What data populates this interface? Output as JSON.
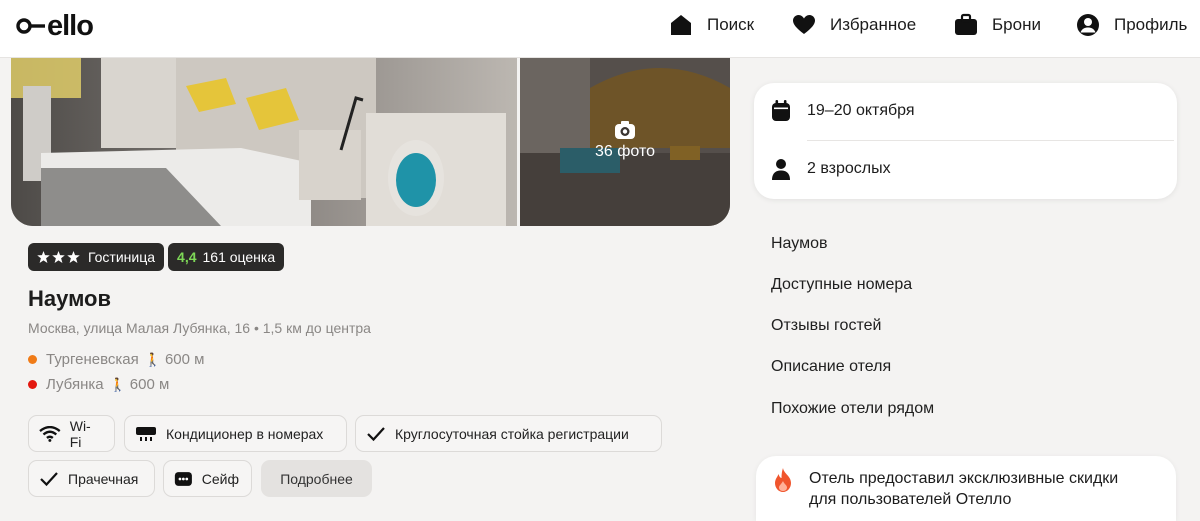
{
  "header": {
    "logo": "ello",
    "nav": [
      {
        "label": "Поиск",
        "icon": "home-icon"
      },
      {
        "label": "Избранное",
        "icon": "heart-icon"
      },
      {
        "label": "Брони",
        "icon": "suitcase-icon"
      },
      {
        "label": "Профиль",
        "icon": "user-icon"
      }
    ]
  },
  "gallery": {
    "photos_count": "36 фото"
  },
  "hotel": {
    "type_badge": "Гостиница",
    "stars": 3,
    "rating": "4,4",
    "reviews": "161 оценка",
    "name": "Наумов",
    "address": "Москва, улица Малая Лубянка, 16 • 1,5 км до центра",
    "metro": [
      {
        "station": "Тургеневская",
        "distance": "600 м",
        "color": "#f07b17"
      },
      {
        "station": "Лубянка",
        "distance": "600 м",
        "color": "#e3180f"
      }
    ]
  },
  "amenities": [
    {
      "label": "Wi-Fi",
      "icon": "wifi-icon"
    },
    {
      "label": "Кондиционер в номерах",
      "icon": "air-conditioner-icon"
    },
    {
      "label": "Круглосуточная стойка регистрации",
      "icon": "check-icon"
    },
    {
      "label": "Прачечная",
      "icon": "check-icon"
    },
    {
      "label": "Сейф",
      "icon": "safe-icon"
    }
  ],
  "more_button": "Подробнее",
  "booking": {
    "dates": "19–20 октября",
    "guests": "2 взрослых"
  },
  "anchors": [
    "Наумов",
    "Доступные номера",
    "Отзывы гостей",
    "Описание отеля",
    "Похожие отели рядом"
  ],
  "promo": {
    "line1": "Отель предоставил эксклюзивные скидки",
    "line2": "для пользователей Отелло"
  },
  "colors": {
    "accent_rating": "#7ed957",
    "badge_bg": "#2b2a29",
    "fire": "#f0552d"
  }
}
